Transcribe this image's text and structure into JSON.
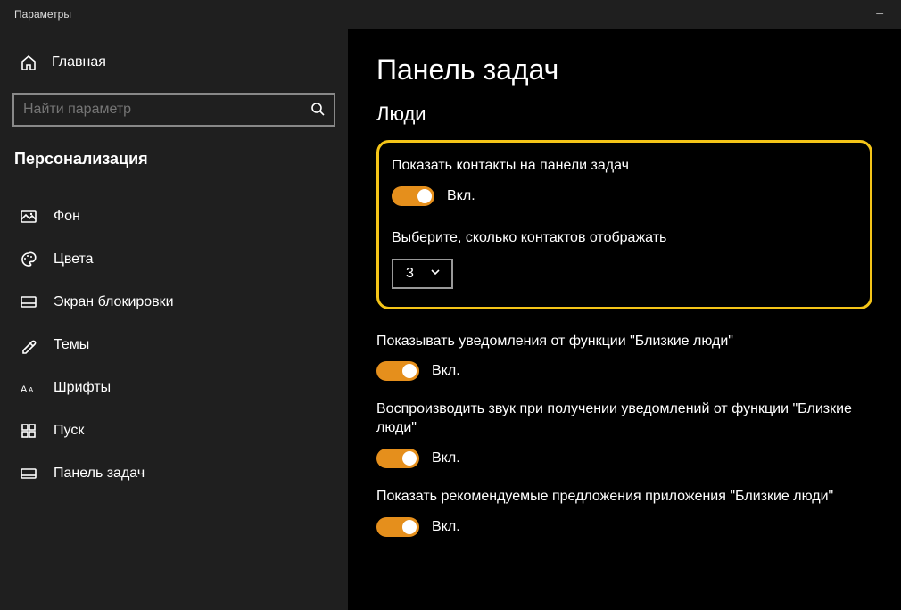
{
  "titlebar": {
    "title": "Параметры"
  },
  "sidebar": {
    "home": "Главная",
    "search_placeholder": "Найти параметр",
    "category": "Персонализация",
    "items": [
      {
        "label": "Фон"
      },
      {
        "label": "Цвета"
      },
      {
        "label": "Экран блокировки"
      },
      {
        "label": "Темы"
      },
      {
        "label": "Шрифты"
      },
      {
        "label": "Пуск"
      },
      {
        "label": "Панель задач"
      }
    ]
  },
  "content": {
    "page_title": "Панель задач",
    "section_title": "Люди",
    "contacts_on_taskbar": {
      "label": "Показать контакты на панели задач",
      "state": "Вкл."
    },
    "contacts_count": {
      "label": "Выберите, сколько контактов отображать",
      "value": "3"
    },
    "notifications": {
      "label": "Показывать уведомления от функции \"Близкие люди\"",
      "state": "Вкл."
    },
    "sound": {
      "label": "Воспроизводить звук при получении уведомлений от функции \"Близкие люди\"",
      "state": "Вкл."
    },
    "suggestions": {
      "label": "Показать рекомендуемые предложения приложения \"Близкие люди\"",
      "state": "Вкл."
    }
  }
}
